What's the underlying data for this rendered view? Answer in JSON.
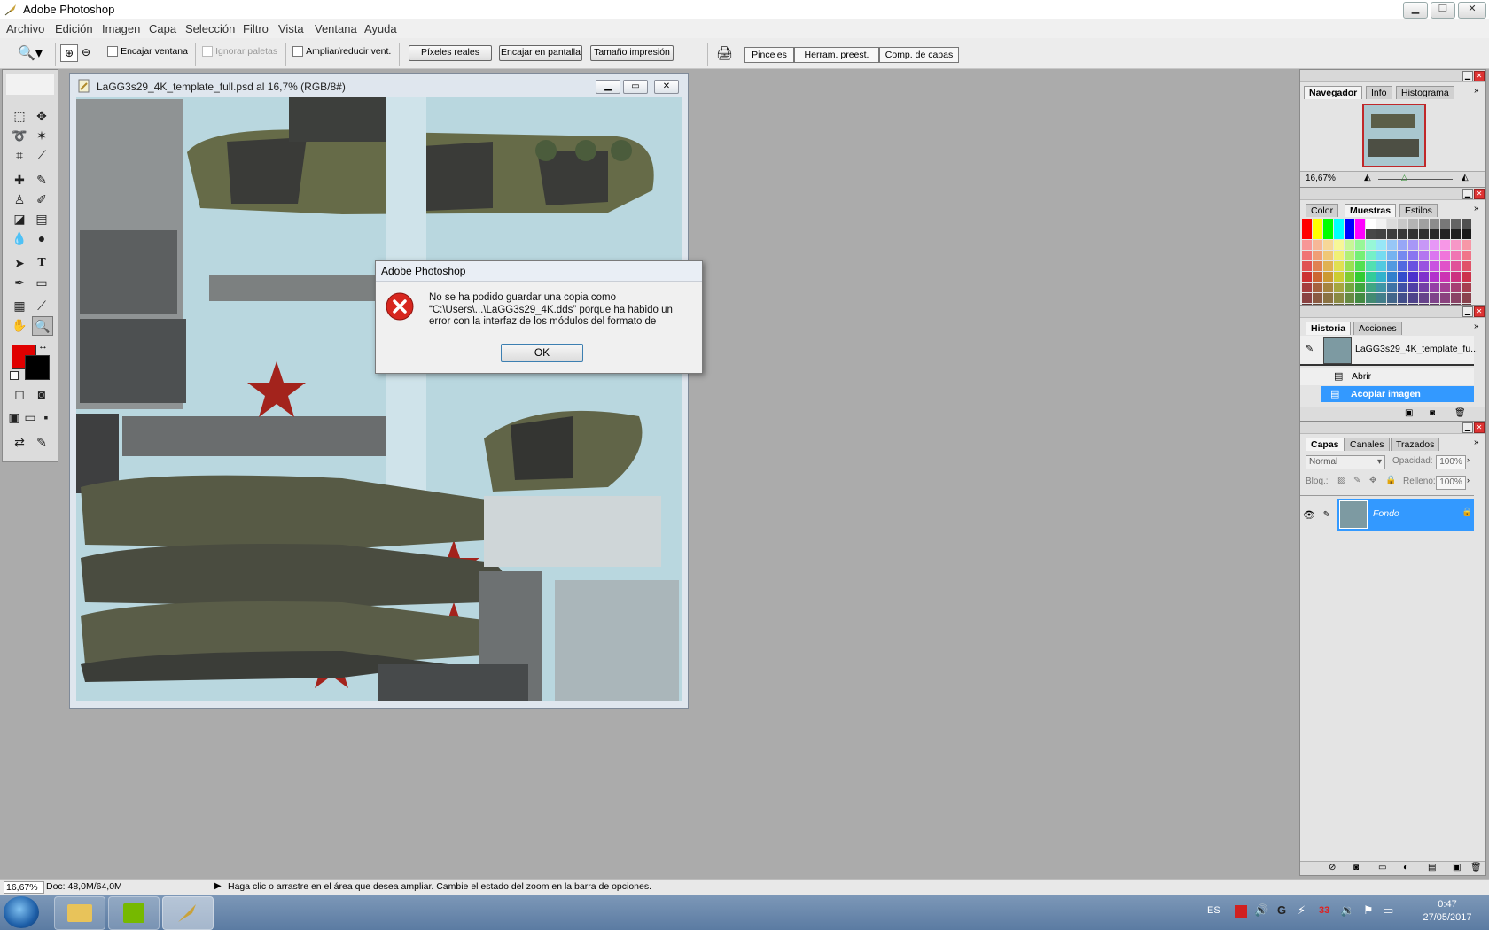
{
  "window": {
    "title": "Adobe Photoshop",
    "controls": [
      "minimize",
      "restore",
      "close"
    ]
  },
  "menubar": {
    "items": [
      "Archivo",
      "Edición",
      "Imagen",
      "Capa",
      "Selección",
      "Filtro",
      "Vista",
      "Ventana",
      "Ayuda"
    ]
  },
  "options": {
    "fit_window": "Encajar ventana",
    "ignore_palettes": "Ignorar paletas",
    "resize_windows": "Ampliar/reducir vent.",
    "actual_pixels": "Píxeles reales",
    "fit_screen": "Encajar en pantalla",
    "print_size": "Tamaño impresión",
    "well_tabs": [
      "Pinceles",
      "Herram. preest.",
      "Comp. de capas"
    ]
  },
  "document": {
    "title": "LaGG3s29_4K_template_full.psd al 16,7% (RGB/8#)"
  },
  "dialog": {
    "title": "Adobe Photoshop",
    "message_lines": [
      "No se ha podido guardar una copia como",
      "“C:\\Users\\...\\LaGG3s29_4K.dds” porque ha habido un",
      "error con la interfaz de los módulos del formato de"
    ],
    "ok_label": "OK",
    "icon": "error-icon"
  },
  "navigator": {
    "tabs": [
      "Navegador",
      "Info",
      "Histograma"
    ],
    "zoom": "16,67%"
  },
  "swatches_panel": {
    "tabs": [
      "Color",
      "Muestras",
      "Estilos"
    ]
  },
  "history": {
    "tabs": [
      "Historia",
      "Acciones"
    ],
    "snapshot": "LaGG3s29_4K_template_fu...",
    "items": [
      "Abrir",
      "Acoplar imagen"
    ]
  },
  "layers": {
    "tabs": [
      "Capas",
      "Canales",
      "Trazados"
    ],
    "blend_mode": "Normal",
    "opacity_label": "Opacidad:",
    "opacity_value": "100%",
    "lock_label": "Bloq.:",
    "fill_label": "Relleno:",
    "fill_value": "100%",
    "layer_name": "Fondo"
  },
  "colors": {
    "foreground": "#e00000",
    "background": "#000000",
    "accent": "#3399ff"
  },
  "status": {
    "zoom": "16,67%",
    "doc": "Doc: 48,0M/64,0M",
    "hint": "Haga clic o arrastre en el área que desea ampliar. Cambie el estado del zoom en la barra de opciones."
  },
  "taskbar": {
    "language": "ES",
    "notification_count": "33",
    "time": "0:47",
    "date": "27/05/2017"
  }
}
